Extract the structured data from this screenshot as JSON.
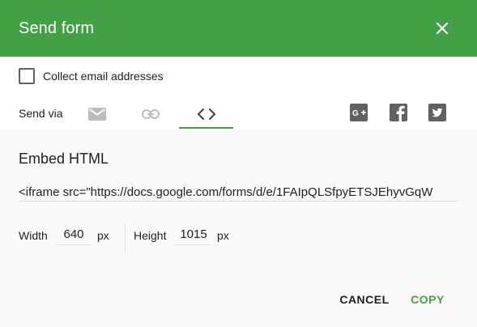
{
  "header": {
    "title": "Send form",
    "close_icon": "close-icon"
  },
  "collect": {
    "label": "Collect email addresses",
    "checked": false
  },
  "send_via": {
    "label": "Send via",
    "tabs": [
      {
        "icon": "email-icon",
        "active": false
      },
      {
        "icon": "link-icon",
        "active": false
      },
      {
        "icon": "embed-code-icon",
        "active": true
      }
    ],
    "social": [
      "google-plus-icon",
      "facebook-icon",
      "twitter-icon"
    ]
  },
  "embed": {
    "heading": "Embed HTML",
    "code": "<iframe src=\"https://docs.google.com/forms/d/e/1FAIpQLSfpyETSJEhyvGqW"
  },
  "dimensions": {
    "width_label": "Width",
    "width_value": "640",
    "height_label": "Height",
    "height_value": "1015",
    "unit": "px"
  },
  "actions": {
    "cancel": "CANCEL",
    "copy": "COPY"
  },
  "colors": {
    "accent": "#43a047",
    "header_text": "#ffffff",
    "icon_muted": "#bdbdbd",
    "icon_dark": "#616161"
  }
}
